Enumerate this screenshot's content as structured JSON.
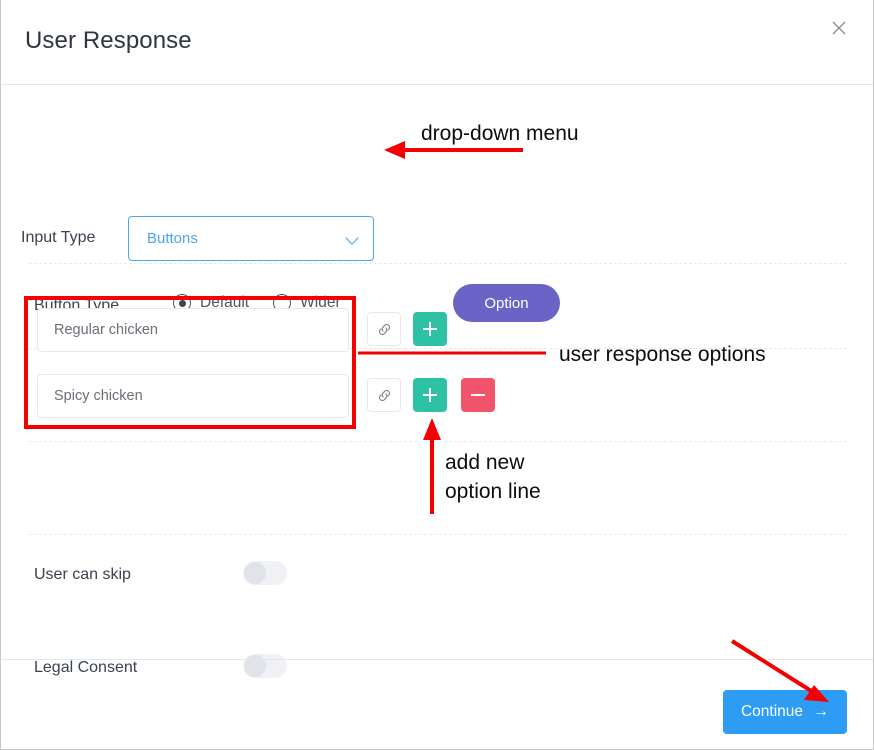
{
  "window": {
    "title": "User Response",
    "close_icon": "close-icon"
  },
  "form": {
    "input_type": {
      "label": "Input Type",
      "value": "Buttons",
      "chevron_icon": "chevron-down-icon",
      "accent_color": "#4da6ec"
    },
    "button_type": {
      "label": "Button Type",
      "options": [
        {
          "label": "Default",
          "selected": true
        },
        {
          "label": "Wider",
          "selected": false
        }
      ],
      "option_pill_label": "Option",
      "option_pill_color": "#6c63c7"
    },
    "response_options": {
      "rows": [
        {
          "value": "Regular chicken",
          "placeholder": "Regular chicken",
          "link_icon": "link-icon",
          "add_icon": "plus-icon",
          "remove_icon": "minus-icon",
          "has_remove": false
        },
        {
          "value": "Spicy chicken",
          "placeholder": "Spicy chicken",
          "link_icon": "link-icon",
          "add_icon": "plus-icon",
          "remove_icon": "minus-icon",
          "has_remove": true
        }
      ],
      "add_color": "#2dc2a5",
      "remove_color": "#f2546b"
    },
    "toggles": [
      {
        "label": "User can skip",
        "on": false
      },
      {
        "label": "Legal Consent",
        "on": false
      }
    ]
  },
  "footer": {
    "continue_label": "Continue",
    "continue_arrow": "→",
    "continue_color": "#2d9cf5"
  },
  "annotations": {
    "color": "#f50000",
    "dropdown_note": "drop-down menu",
    "options_note": "user response options",
    "add_note_line1": "add new",
    "add_note_line2": "option line"
  }
}
